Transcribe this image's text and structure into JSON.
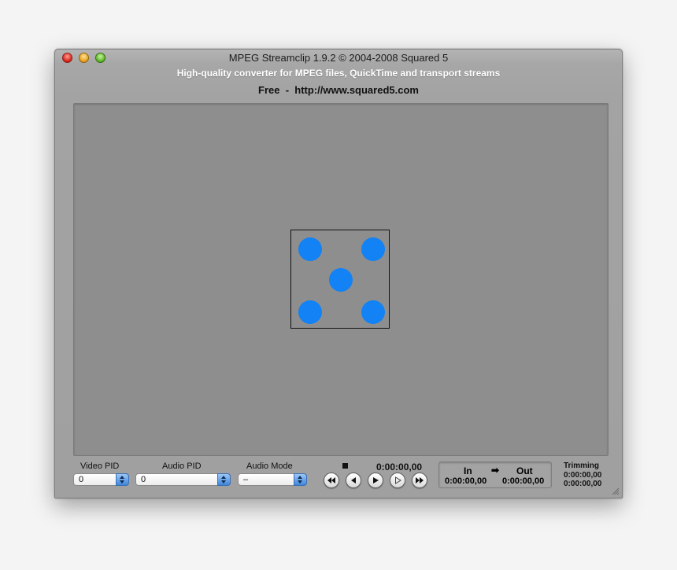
{
  "window": {
    "title": "MPEG Streamclip 1.9.2 © 2004-2008 Squared 5",
    "subtitle": "High-quality converter for MPEG files, QuickTime and transport streams",
    "free_label": "Free",
    "separator": "  -  ",
    "url": "http://www.squared5.com"
  },
  "viewer": {
    "placeholder_icon": "dice-five-icon",
    "pip_color": "#1282f4"
  },
  "controls": {
    "video_pid": {
      "label": "Video PID",
      "value": "0"
    },
    "audio_pid": {
      "label": "Audio PID",
      "value": "0"
    },
    "audio_mode": {
      "label": "Audio Mode",
      "value": "–"
    },
    "current_time": "0:00:00,00",
    "transport": {
      "stop_icon": "stop-icon",
      "buttons": [
        "rewind-icon",
        "step-back-icon",
        "play-icon",
        "play-outline-icon",
        "fast-forward-icon"
      ]
    },
    "in_out": {
      "in_label": "In",
      "arrow": "➡",
      "out_label": "Out",
      "in_time": "0:00:00,00",
      "out_time": "0:00:00,00"
    },
    "trimming": {
      "label": "Trimming",
      "value1": "0:00:00,00",
      "value2": "0:00:00,00"
    }
  }
}
